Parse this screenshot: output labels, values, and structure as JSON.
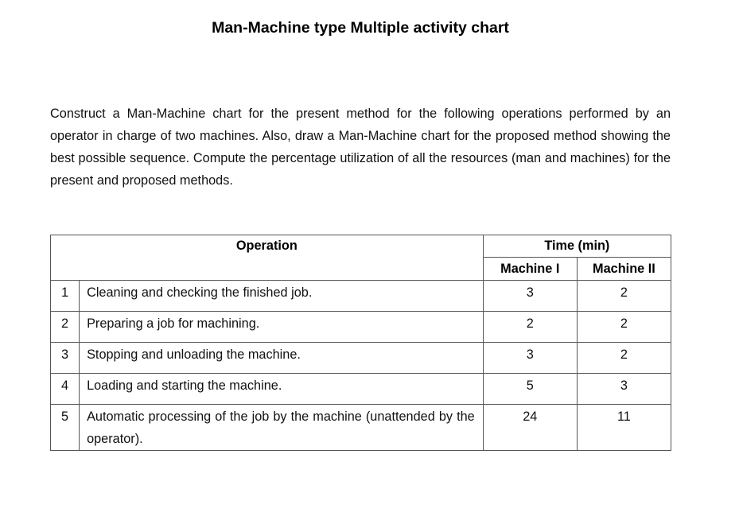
{
  "document": {
    "title": "Man-Machine type Multiple activity chart",
    "paragraph": "Construct a Man-Machine chart for the present method for the following operations performed by an operator in charge of two machines. Also, draw a Man-Machine chart for the proposed method showing the best possible sequence. Compute the percentage utilization of all the resources (man and machines) for the present and proposed methods."
  },
  "table": {
    "header": {
      "operation": "Operation",
      "time_group": "Time (min)",
      "machine1": "Machine I",
      "machine2": "Machine II"
    },
    "rows": [
      {
        "num": "1",
        "operation": "Cleaning and checking the finished job.",
        "machine1": "3",
        "machine2": "2"
      },
      {
        "num": "2",
        "operation": "Preparing a job for machining.",
        "machine1": "2",
        "machine2": "2"
      },
      {
        "num": "3",
        "operation": "Stopping and unloading the machine.",
        "machine1": "3",
        "machine2": "2"
      },
      {
        "num": "4",
        "operation": "Loading and starting the machine.",
        "machine1": "5",
        "machine2": "3"
      },
      {
        "num": "5",
        "operation": "Automatic processing of the job by the machine (unattended by the operator).",
        "machine1": "24",
        "machine2": "11"
      }
    ]
  }
}
